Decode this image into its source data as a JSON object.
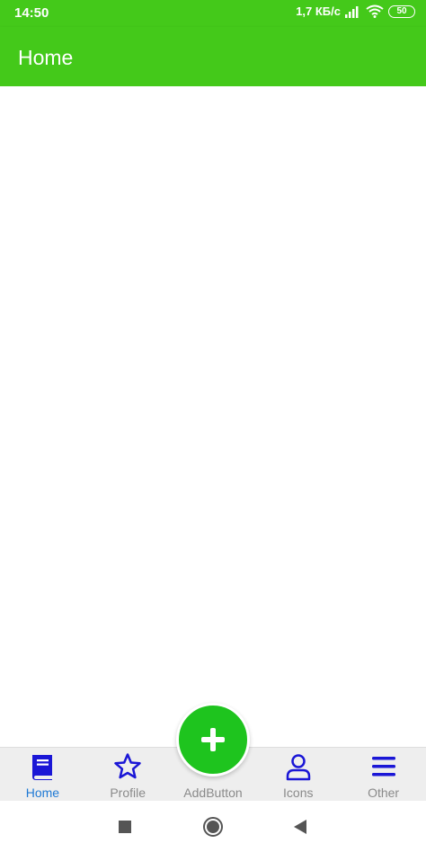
{
  "status_bar": {
    "time": "14:50",
    "network_speed": "1,7 КБ/с",
    "battery": "50",
    "icons": [
      "signal-icon",
      "wifi-icon",
      "battery-icon"
    ]
  },
  "app_bar": {
    "title": "Home",
    "color": "#44c91a"
  },
  "bottom_nav": {
    "items": [
      {
        "label": "Home",
        "icon": "book-icon",
        "active": true
      },
      {
        "label": "Profile",
        "icon": "star-icon",
        "active": false
      },
      {
        "label": "AddButton",
        "icon": "plus-icon",
        "active": false
      },
      {
        "label": "Icons",
        "icon": "person-icon",
        "active": false
      },
      {
        "label": "Other",
        "icon": "menu-icon",
        "active": false
      }
    ],
    "icon_color": "#1a16d6",
    "active_label_color": "#1f79d4",
    "inactive_label_color": "#8a8a8a",
    "fab_color": "#1ec41e"
  },
  "system_nav": {
    "buttons": [
      "recents-button",
      "home-button",
      "back-button"
    ]
  }
}
